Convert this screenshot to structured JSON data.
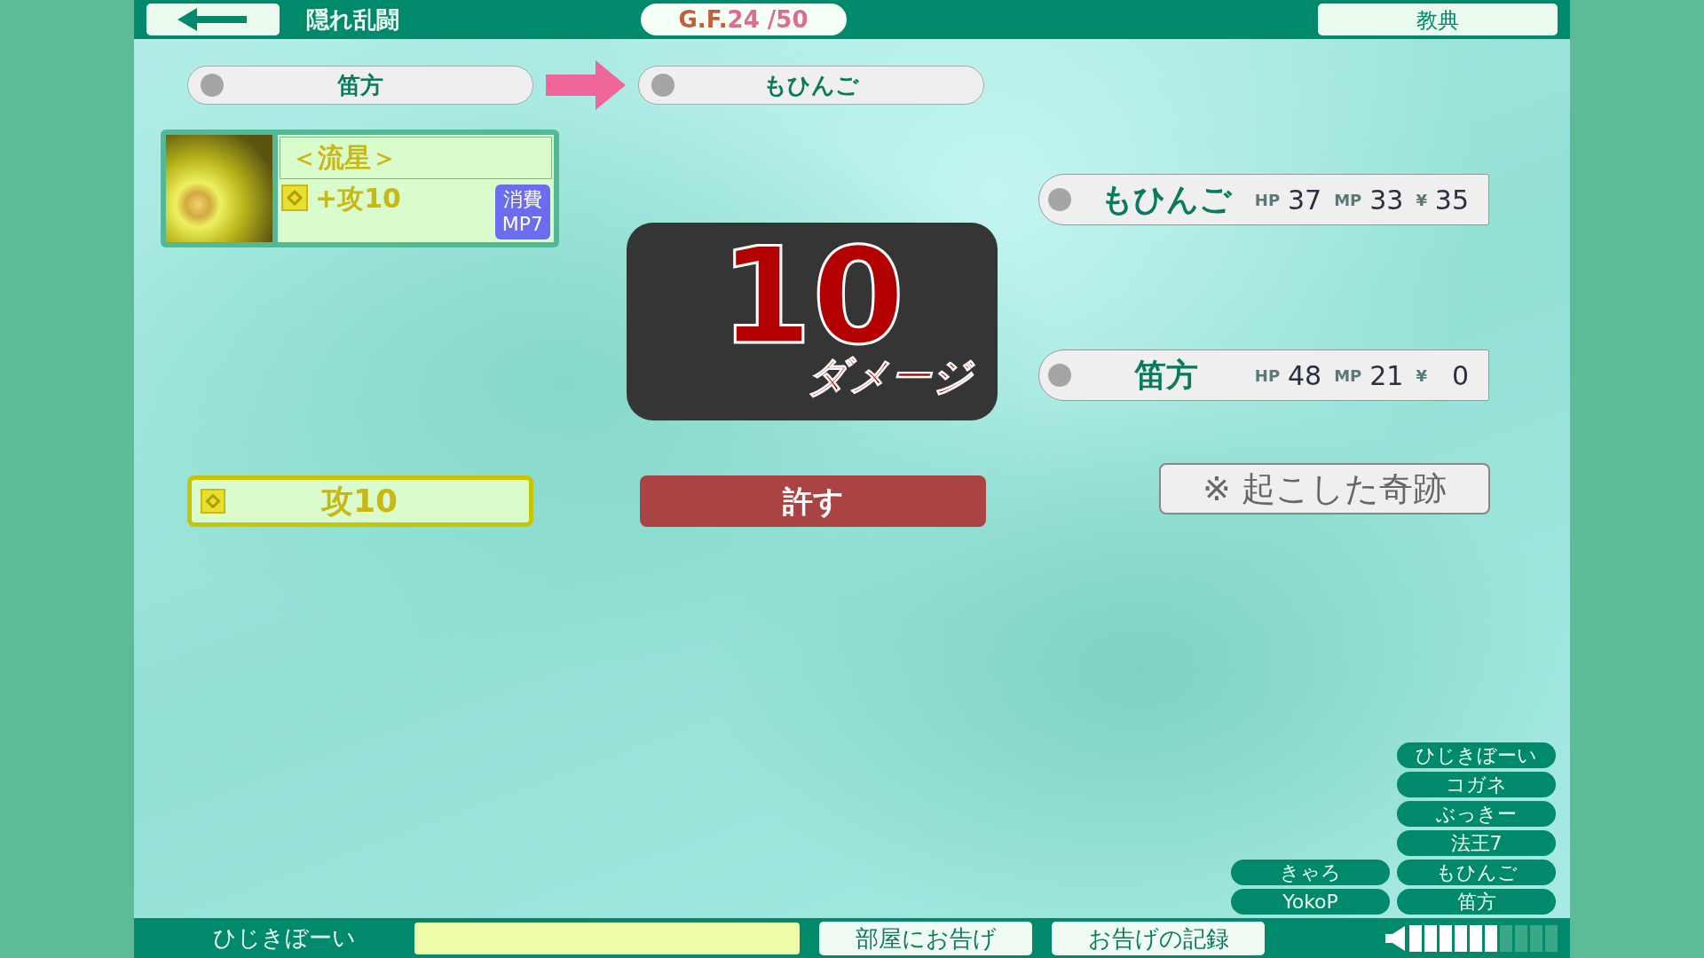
{
  "header": {
    "title": "隠れ乱闘",
    "round_prefix": "G.F.",
    "round_value": "24 /50",
    "manual_button": "教典"
  },
  "turn": {
    "from": "笛方",
    "to": "もひんご"
  },
  "card": {
    "title": "＜流星＞",
    "effect": "+攻10",
    "cost_lines": [
      "消費",
      "MP7"
    ]
  },
  "damage": {
    "value": "10",
    "label": "ダメージ"
  },
  "players": [
    {
      "name": "もひんご",
      "hp_label": "HP",
      "hp": "37",
      "mp_label": "MP",
      "mp": "33",
      "money_label": "¥",
      "money": "35"
    },
    {
      "name": "笛方",
      "hp_label": "HP",
      "hp": "48",
      "mp_label": "MP",
      "mp": "21",
      "money_label": "¥",
      "money": "0"
    }
  ],
  "actions": {
    "bonus": "攻10",
    "forgive_button": "許す",
    "miracle_button": "※ 起こした奇跡"
  },
  "roster": {
    "left": [
      "きゃろ",
      "YokoP"
    ],
    "right": [
      "ひじきぼーい",
      "コガネ",
      "ぶっきー",
      "法王7",
      "もひんご",
      "笛方"
    ]
  },
  "footer": {
    "player_name": "ひじきぼーい",
    "announce_button": "部屋にお告げ",
    "log_button": "お告げの記録",
    "volume": {
      "level": 0.6
    }
  }
}
